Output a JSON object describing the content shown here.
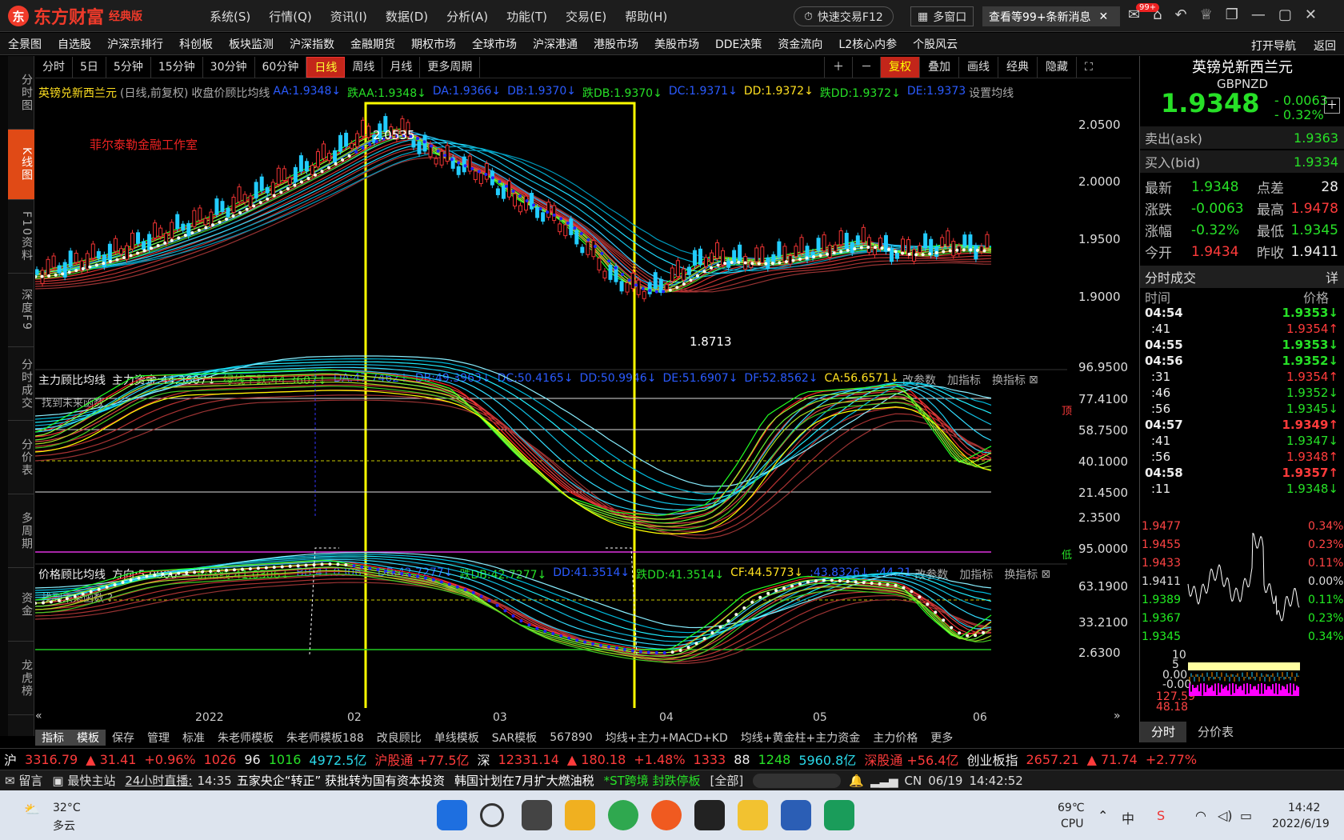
{
  "app": {
    "brand": "东方财富",
    "edition": "经典版",
    "menu": [
      "系统(S)",
      "行情(Q)",
      "资讯(I)",
      "数据(D)",
      "分析(A)",
      "功能(T)",
      "交易(E)",
      "帮助(H)"
    ],
    "quick_trade": "快速交易F12",
    "multi_window": "多窗口",
    "message": "查看等99+条新消息",
    "badge": "99+"
  },
  "nav": {
    "items": [
      "全景图",
      "自选股",
      "沪深京排行",
      "科创板",
      "板块监测",
      "沪深指数",
      "金融期货",
      "期权市场",
      "全球市场",
      "沪深港通",
      "港股市场",
      "美股市场",
      "DDE决策",
      "资金流向",
      "L2核心内参",
      "个股风云"
    ],
    "right": [
      "打开导航",
      "返回"
    ]
  },
  "side_tabs": [
    {
      "label": "分时图"
    },
    {
      "label": "K线图"
    },
    {
      "label": "F10资料"
    },
    {
      "label": "深度F9"
    },
    {
      "label": "分时成交"
    },
    {
      "label": "分价表"
    },
    {
      "label": "多周期"
    },
    {
      "label": "资金"
    },
    {
      "label": "龙虎榜"
    }
  ],
  "periods": [
    "分时",
    "5日",
    "5分钟",
    "15分钟",
    "30分钟",
    "60分钟",
    "日线",
    "周线",
    "月线",
    "更多周期"
  ],
  "tools": [
    "复权",
    "叠加",
    "画线",
    "经典",
    "隐藏"
  ],
  "main_legend": {
    "name": "英镑兑新西兰元",
    "type": "(日线,前复权)",
    "indicator": "收盘价顾比均线",
    "items": [
      {
        "t": "AA:1.9348↓",
        "c": "blu"
      },
      {
        "t": "跌AA:1.9348↓",
        "c": "grn"
      },
      {
        "t": "DA:1.9366↓",
        "c": "blu"
      },
      {
        "t": "DB:1.9370↓",
        "c": "blu"
      },
      {
        "t": "跌DB:1.9370↓",
        "c": "grn"
      },
      {
        "t": "DC:1.9371↓",
        "c": "blu"
      },
      {
        "t": "DD:1.9372↓",
        "c": "yel"
      },
      {
        "t": "跌DD:1.9372↓",
        "c": "grn"
      },
      {
        "t": "DE:1.9373",
        "c": "blu"
      }
    ],
    "settings": "设置均线"
  },
  "watermark": "菲尔泰勒金融工作室",
  "hi_label": "2.0535",
  "lo_label": "1.8713",
  "price_ticks": [
    "2.0500",
    "2.0000",
    "1.9500",
    "1.9000"
  ],
  "ind1_legend": {
    "items": [
      {
        "t": "主力顾比均线",
        "c": "wht"
      },
      {
        "t": "主力资金:44.3607↓",
        "c": "wht"
      },
      {
        "t": "绿线下跌:44.3607↓",
        "c": "grn"
      },
      {
        "t": "DA:47.7462↓",
        "c": "blu"
      },
      {
        "t": "DB:49.3963↓",
        "c": "blu"
      },
      {
        "t": "DC:50.4165↓",
        "c": "blu"
      },
      {
        "t": "DD:50.9946↓",
        "c": "blu"
      },
      {
        "t": "DE:51.6907↓",
        "c": "blu"
      },
      {
        "t": "DF:52.8562↓",
        "c": "blu"
      },
      {
        "t": "CA:56.6571↓",
        "c": "yel"
      }
    ],
    "actions": [
      "改参数",
      "加指标",
      "换指标"
    ],
    "note": "找到未来函数",
    "top": "顶",
    "bottom": "低"
  },
  "ind1_ticks": [
    "96.9500",
    "77.4100",
    "58.7500",
    "40.1000",
    "21.4500",
    "2.3500"
  ],
  "ind2_legend": {
    "items": [
      {
        "t": "价格顾比均线",
        "c": "wht"
      },
      {
        "t": "方向:5.0000 −",
        "c": "wht"
      },
      {
        "t": "价格线:41.0306↓",
        "c": "grn"
      },
      {
        "t": "BB:41.0306↓",
        "c": "blu"
      },
      {
        "t": "DB:42.7277↓",
        "c": "blu"
      },
      {
        "t": "跌DB:42.7277↓",
        "c": "grn"
      },
      {
        "t": "DD:41.3514↓",
        "c": "blu"
      },
      {
        "t": "跌DD:41.3514↓",
        "c": "grn"
      },
      {
        "t": "CF:44.5773↓",
        "c": "yel"
      },
      {
        "t": ":43.8326↓",
        "c": "blu"
      },
      {
        "t": ":44.21",
        "c": "blu"
      }
    ],
    "actions": [
      "改参数",
      "加指标",
      "换指标"
    ],
    "note": "找到未来函数 ?"
  },
  "ind2_ticks": [
    "95.0000",
    "63.1900",
    "33.2100",
    "2.6300"
  ],
  "xaxis": [
    "2022",
    "02",
    "03",
    "04",
    "05",
    "06"
  ],
  "templates": [
    "指标",
    "模板",
    "保存",
    "管理",
    "标准",
    "朱老师模板",
    "朱老师模板188",
    "改良顾比",
    "单线模板",
    "SAR模板",
    "567890",
    "均线+主力+MACD+KD",
    "均线+黄金柱+主力资金",
    "主力价格",
    "更多"
  ],
  "quote": {
    "name": "英镑兑新西兰元",
    "code": "GBPNZD",
    "price": "1.9348",
    "change": "- 0.0063",
    "pct": "- 0.32%",
    "ask_label": "卖出(ask)",
    "ask": "1.9363",
    "bid_label": "买入(bid)",
    "bid": "1.9334",
    "grid": [
      {
        "l": "最新",
        "v": "1.9348",
        "l2": "点差",
        "v2": "28"
      },
      {
        "l": "涨跌",
        "v": "-0.0063",
        "l2": "最高",
        "v2": "1.9478"
      },
      {
        "l": "涨幅",
        "v": "-0.32%",
        "l2": "最低",
        "v2": "1.9345"
      },
      {
        "l": "今开",
        "v": "1.9434",
        "l2": "昨收",
        "v2": "1.9411"
      }
    ],
    "ticks_title": "分时成交",
    "detail": "详",
    "col_time": "时间",
    "col_price": "价格",
    "ticks": [
      {
        "t": "04:54",
        "p": "1.9353↓",
        "c": "grn"
      },
      {
        "t": ":41",
        "p": "1.9354↑",
        "c": "red"
      },
      {
        "t": "04:55",
        "p": "1.9353↓",
        "c": "grn"
      },
      {
        "t": "04:56",
        "p": "1.9352↓",
        "c": "grn"
      },
      {
        "t": ":31",
        "p": "1.9354↑",
        "c": "red"
      },
      {
        "t": ":46",
        "p": "1.9352↓",
        "c": "grn"
      },
      {
        "t": ":56",
        "p": "1.9345↓",
        "c": "grn"
      },
      {
        "t": "04:57",
        "p": "1.9349↑",
        "c": "red"
      },
      {
        "t": ":41",
        "p": "1.9347↓",
        "c": "grn"
      },
      {
        "t": ":56",
        "p": "1.9348↑",
        "c": "red"
      },
      {
        "t": "04:58",
        "p": "1.9357↑",
        "c": "red"
      },
      {
        "t": ":11",
        "p": "1.9348↓",
        "c": "grn"
      }
    ],
    "mini_left": [
      "1.9477",
      "1.9455",
      "1.9433",
      "1.9411",
      "1.9389",
      "1.9367",
      "1.9345"
    ],
    "mini_right": [
      "0.34%",
      "0.23%",
      "0.11%",
      "0.00%",
      "0.11%",
      "0.23%",
      "0.34%"
    ],
    "macd_left": [
      "10",
      "5",
      "0.00",
      "-0.00",
      "127.59",
      "48.18"
    ],
    "tabs": [
      "分时",
      "分价表"
    ]
  },
  "ticker": [
    {
      "t": "沪",
      "c": "wht"
    },
    {
      "t": "3316.79",
      "c": "red"
    },
    {
      "t": "▲ 31.41",
      "c": "red"
    },
    {
      "t": "+0.96%",
      "c": "red"
    },
    {
      "t": "1026",
      "c": "red"
    },
    {
      "t": "96",
      "c": "wht"
    },
    {
      "t": "1016",
      "c": "grn"
    },
    {
      "t": "4972.5亿",
      "c": "cyan"
    },
    {
      "t": "沪股通 +77.5亿",
      "c": "red"
    },
    {
      "t": "深",
      "c": "wht"
    },
    {
      "t": "12331.14",
      "c": "red"
    },
    {
      "t": "▲ 180.18",
      "c": "red"
    },
    {
      "t": "+1.48%",
      "c": "red"
    },
    {
      "t": "1333",
      "c": "red"
    },
    {
      "t": "88",
      "c": "wht"
    },
    {
      "t": "1248",
      "c": "grn"
    },
    {
      "t": "5960.8亿",
      "c": "cyan"
    },
    {
      "t": "深股通 +56.4亿",
      "c": "red"
    },
    {
      "t": "创业板指",
      "c": "wht"
    },
    {
      "t": "2657.21",
      "c": "red"
    },
    {
      "t": "▲ 71.74",
      "c": "red"
    },
    {
      "t": "+2.77%",
      "c": "red"
    }
  ],
  "news": {
    "msg": "留言",
    "main": "最快主站",
    "live": "24小时直播:",
    "time": "14:35",
    "headline": "五家央企“转正” 获批转为国有资本投资",
    "headline2": "韩国计划在7月扩大燃油税",
    "stock": "*ST跨境 封跌停板",
    "all": "[全部]",
    "cn": "CN",
    "date": "06/19",
    "clock": "14:42:52"
  },
  "taskbar": {
    "temp": "32°C",
    "weather": "多云",
    "cpu_temp": "69℃",
    "cpu": "CPU",
    "time": "14:42",
    "date": "2022/6/19"
  }
}
